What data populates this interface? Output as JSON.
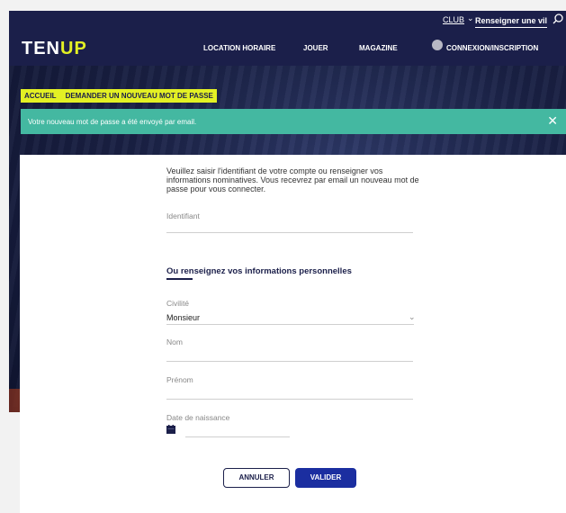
{
  "utility_bar": {
    "club_label": "CLUB",
    "search_value": "Renseigner une vil",
    "icons": [
      "chevron-down-icon",
      "search-icon"
    ]
  },
  "nav": {
    "logo_prefix": "TEN",
    "logo_accent": "UP",
    "items": [
      "LOCATION HORAIRE",
      "JOUER",
      "MAGAZINE"
    ],
    "login_label": "CONNEXION/INSCRIPTION"
  },
  "breadcrumb": {
    "items": [
      "ACCUEIL",
      "DEMANDER UN NOUVEAU MOT DE PASSE"
    ]
  },
  "alert": {
    "message": "Votre nouveau mot de passe a été envoyé par email.",
    "close_icon": "close-icon"
  },
  "form": {
    "intro": "Veuillez saisir l'identifiant de votre compte ou renseigner vos informations nominatives. Vous recevrez par email un nouveau mot de passe pour vous connecter.",
    "identifiant_label": "Identifiant",
    "identifiant_value": "",
    "section_title": "Ou renseignez vos informations personnelles",
    "civilite_label": "Civilité",
    "civilite_value": "Monsieur",
    "nom_label": "Nom",
    "nom_value": "",
    "prenom_label": "Prénom",
    "prenom_value": "",
    "birthdate_label": "Date de naissance",
    "birthdate_value": "",
    "cancel_label": "ANNULER",
    "submit_label": "VALIDER"
  },
  "colors": {
    "navy": "#1b1f4a",
    "accent_yellow": "#e3f024",
    "success_green": "#44b8a1",
    "button_blue": "#1b2ea0"
  }
}
